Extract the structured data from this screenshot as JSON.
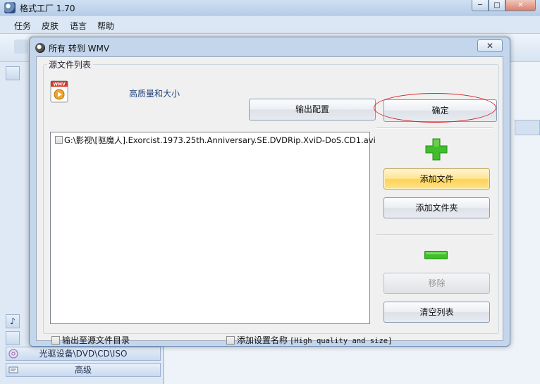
{
  "app": {
    "title": "格式工厂 1.70",
    "window_buttons": {
      "minimize": "─",
      "maximize": "□",
      "close": "✕"
    }
  },
  "menu": [
    "任务",
    "皮肤",
    "语言",
    "帮助"
  ],
  "left_panel": {
    "items": [
      {
        "label": "光驱设备\\DVD\\CD\\ISO",
        "icon": "disc-icon"
      },
      {
        "label": "高级",
        "icon": "advanced-icon"
      }
    ]
  },
  "dialog": {
    "title": "所有 转到 WMV",
    "close_label": "✕",
    "group_label": "源文件列表",
    "format_icon_text": "WMV",
    "quality_label": "高质量和大小",
    "output_config_button": "输出配置",
    "ok_button": "确定",
    "files": [
      "G:\\影视\\[驱魔人].Exorcist.1973.25th.Anniversary.SE.DVDRip.XviD-DoS.CD1.avi"
    ],
    "add_file_button": "添加文件",
    "add_folder_button": "添加文件夹",
    "remove_button": "移除",
    "clear_list_button": "清空列表",
    "output_to_source_dir_label": "输出至源文件目录",
    "add_setting_name_label": "添加设置名称",
    "setting_name_hint": "[High quality and size]"
  },
  "colors": {
    "highlight_ellipse": "#d9232a",
    "add_file_button_bg": "#ffd255",
    "plus_green": "#3fbf2b",
    "minus_green": "#3fbf2b"
  }
}
